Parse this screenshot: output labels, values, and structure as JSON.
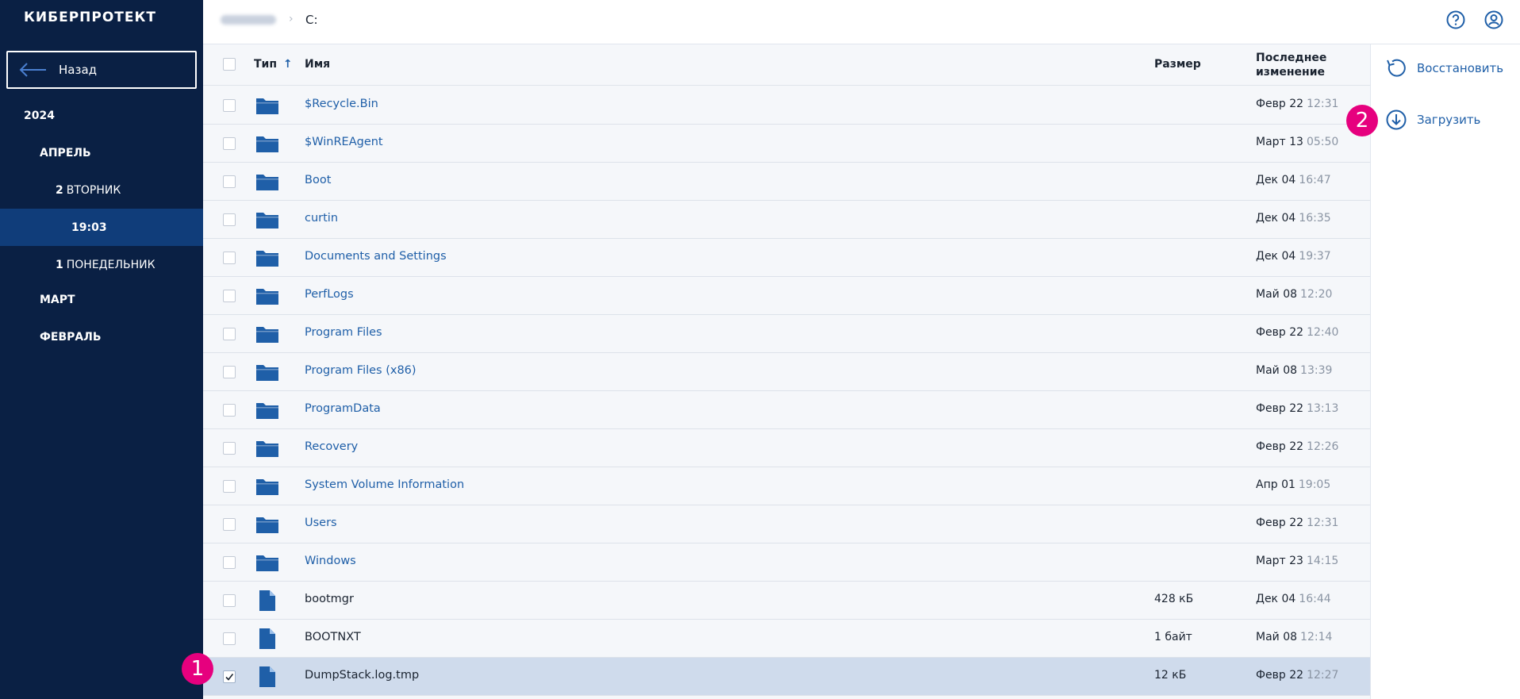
{
  "sidebar": {
    "logo": "КИБЕРПРОТЕКТ",
    "back_label": "Назад",
    "tree": {
      "year": "2024",
      "april": "АПРЕЛЬ",
      "day2_num": "2",
      "day2_label": "ВТОРНИК",
      "time_selected": "19:03",
      "day1_num": "1",
      "day1_label": "ПОНЕДЕЛЬНИК",
      "march": "МАРТ",
      "february": "ФЕВРАЛЬ"
    }
  },
  "header": {
    "breadcrumb_current": "C:",
    "help_icon": "help-circle-icon",
    "account_icon": "user-circle-icon"
  },
  "table": {
    "columns": {
      "type": "Тип",
      "name": "Имя",
      "size": "Размер",
      "modified_line1": "Последнее",
      "modified_line2": "изменение"
    },
    "rows": [
      {
        "kind": "folder",
        "name": "$Recycle.Bin",
        "size": "",
        "date": "Февр 22",
        "time": "12:31",
        "checked": false
      },
      {
        "kind": "folder",
        "name": "$WinREAgent",
        "size": "",
        "date": "Март 13",
        "time": "05:50",
        "checked": false
      },
      {
        "kind": "folder",
        "name": "Boot",
        "size": "",
        "date": "Дек 04",
        "time": "16:47",
        "checked": false
      },
      {
        "kind": "folder",
        "name": "curtin",
        "size": "",
        "date": "Дек 04",
        "time": "16:35",
        "checked": false
      },
      {
        "kind": "folder",
        "name": "Documents and Settings",
        "size": "",
        "date": "Дек 04",
        "time": "19:37",
        "checked": false
      },
      {
        "kind": "folder",
        "name": "PerfLogs",
        "size": "",
        "date": "Май 08",
        "time": "12:20",
        "checked": false
      },
      {
        "kind": "folder",
        "name": "Program Files",
        "size": "",
        "date": "Февр 22",
        "time": "12:40",
        "checked": false
      },
      {
        "kind": "folder",
        "name": "Program Files (x86)",
        "size": "",
        "date": "Май 08",
        "time": "13:39",
        "checked": false
      },
      {
        "kind": "folder",
        "name": "ProgramData",
        "size": "",
        "date": "Февр 22",
        "time": "13:13",
        "checked": false
      },
      {
        "kind": "folder",
        "name": "Recovery",
        "size": "",
        "date": "Февр 22",
        "time": "12:26",
        "checked": false
      },
      {
        "kind": "folder",
        "name": "System Volume Information",
        "size": "",
        "date": "Апр 01",
        "time": "19:05",
        "checked": false
      },
      {
        "kind": "folder",
        "name": "Users",
        "size": "",
        "date": "Февр 22",
        "time": "12:31",
        "checked": false
      },
      {
        "kind": "folder",
        "name": "Windows",
        "size": "",
        "date": "Март 23",
        "time": "14:15",
        "checked": false
      },
      {
        "kind": "file",
        "name": "bootmgr",
        "size": "428 кБ",
        "date": "Дек 04",
        "time": "16:44",
        "checked": false
      },
      {
        "kind": "file",
        "name": "BOOTNXT",
        "size": "1 байт",
        "date": "Май 08",
        "time": "12:14",
        "checked": false
      },
      {
        "kind": "file",
        "name": "DumpStack.log.tmp",
        "size": "12 кБ",
        "date": "Февр 22",
        "time": "12:27",
        "checked": true
      }
    ]
  },
  "actions": {
    "restore": "Восстановить",
    "download": "Загрузить"
  },
  "markers": {
    "m1": "1",
    "m2": "2"
  },
  "colors": {
    "sidebar_bg": "#0a2044",
    "sidebar_active": "#103d7a",
    "link": "#1f5fa8",
    "marker": "#e6007e",
    "selected_row": "#cfdbec"
  }
}
